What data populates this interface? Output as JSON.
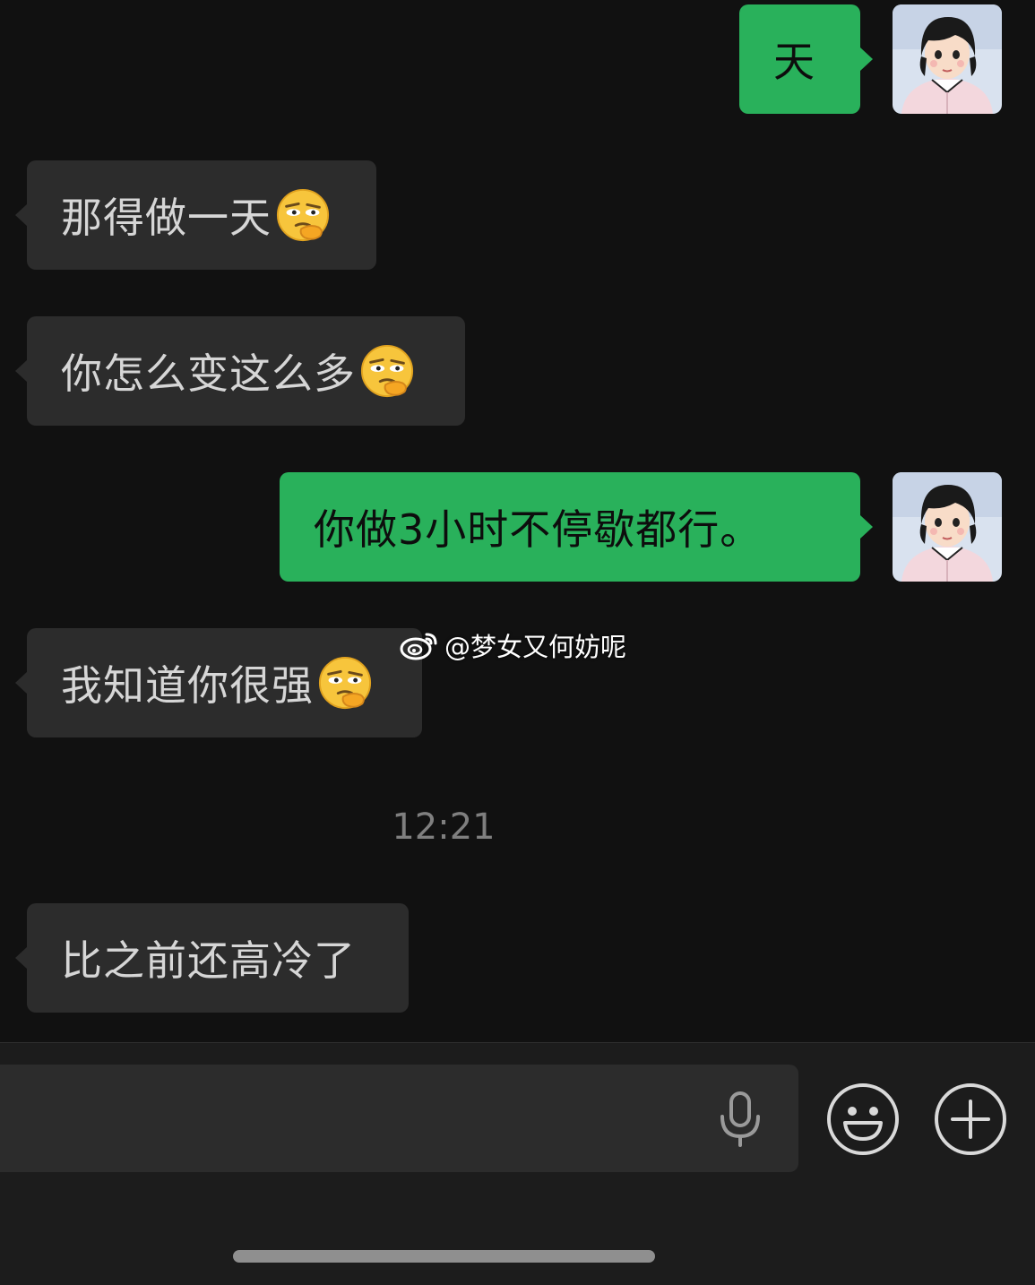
{
  "messages": [
    {
      "text": "天"
    },
    {
      "text": "那得做一天"
    },
    {
      "text": "你怎么变这么多"
    },
    {
      "text": "你做3小时不停歇都行。"
    },
    {
      "text": "我知道你很强"
    },
    {
      "text": "比之前还高冷了"
    }
  ],
  "timestamp": "12:21",
  "watermark": "@梦女又何妨呢",
  "icons": {
    "emoji": "thinking-face-icon",
    "voice": "microphone-icon",
    "sticker": "smiley-face-icon",
    "more": "plus-icon",
    "watermark_logo": "weibo-logo-icon"
  },
  "colors": {
    "background": "#111111",
    "incoming_bubble": "#2c2c2c",
    "outgoing_bubble": "#29b15b"
  }
}
